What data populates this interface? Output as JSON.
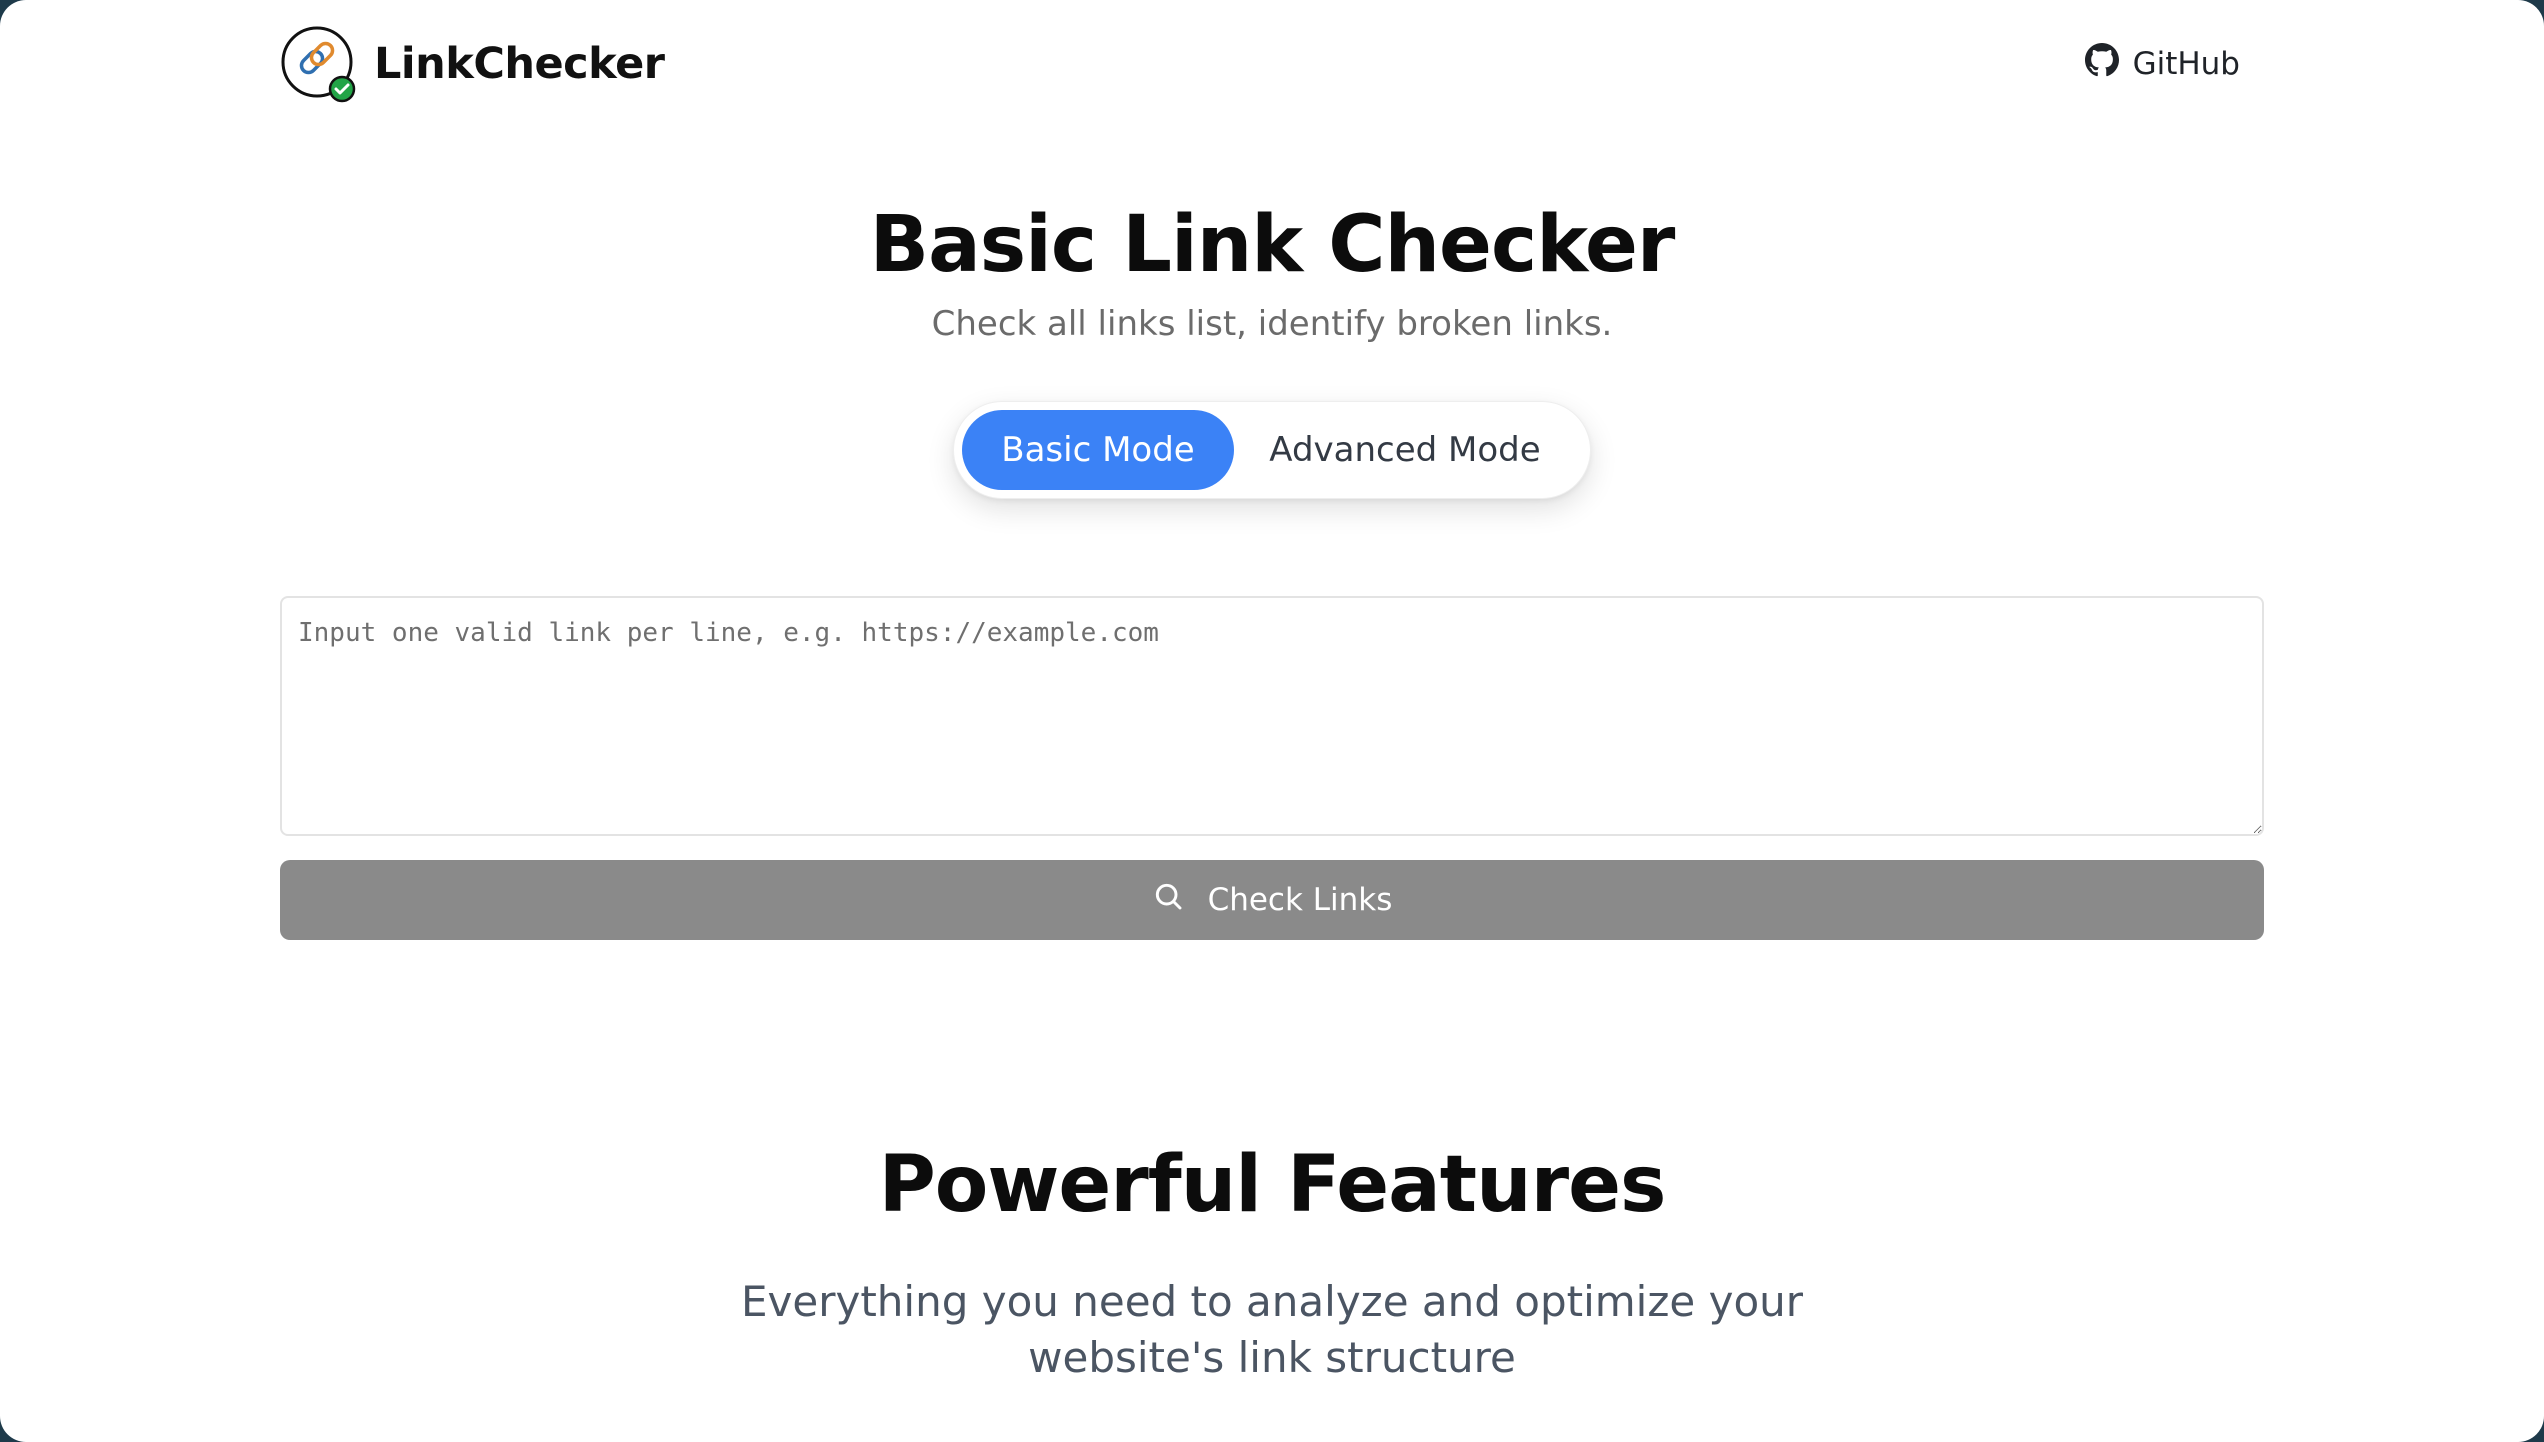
{
  "header": {
    "brand_name": "LinkChecker",
    "github_label": "GitHub",
    "logo_icon": "chain-link-check-icon"
  },
  "hero": {
    "title": "Basic Link Checker",
    "subtitle": "Check all links list, identify broken links."
  },
  "modes": {
    "basic_label": "Basic Mode",
    "advanced_label": "Advanced Mode",
    "selected": "Basic Mode"
  },
  "input": {
    "value": "",
    "placeholder": "Input one valid link per line, e.g. https://example.com"
  },
  "check_button": {
    "label": "Check Links",
    "icon": "search-icon"
  },
  "features": {
    "title": "Powerful Features",
    "subtitle": "Everything you need to analyze and optimize your website's link structure"
  },
  "colors": {
    "accent": "#3b82f6",
    "button_disabled": "#8a8a8a",
    "check_badge": "#22a447"
  }
}
